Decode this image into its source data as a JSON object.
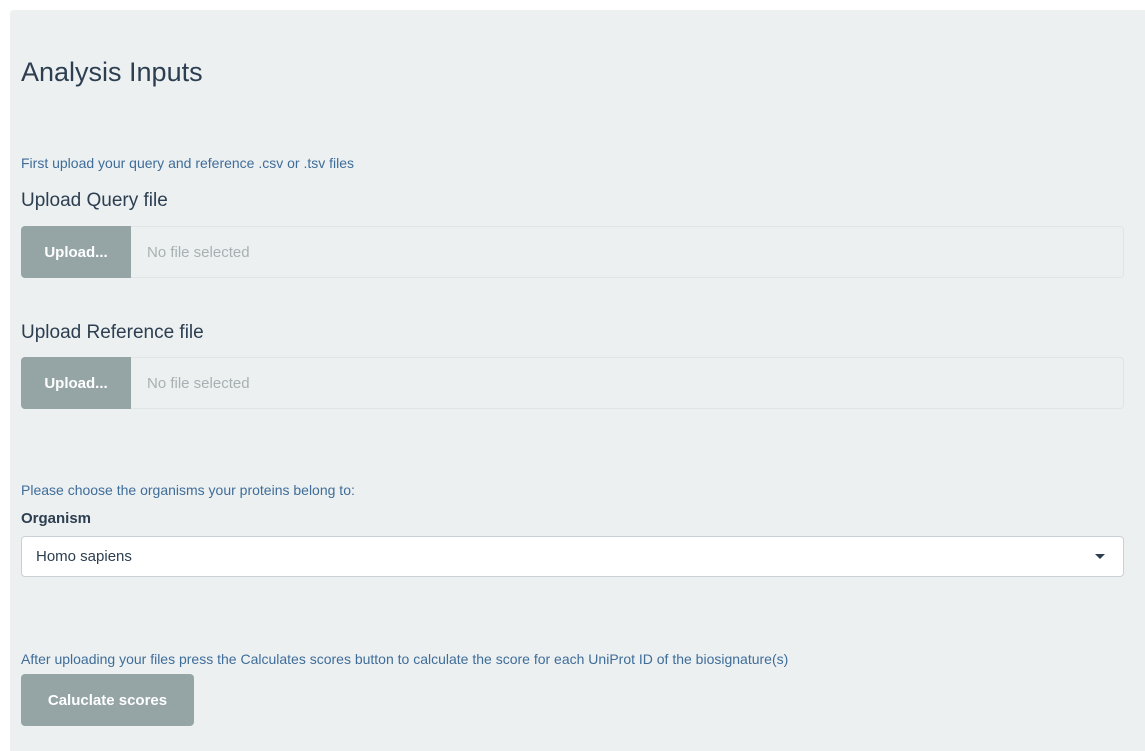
{
  "page": {
    "title": "Analysis Inputs"
  },
  "upload_section": {
    "help_text": "First upload your query and reference .csv or .tsv files",
    "query": {
      "label": "Upload Query file",
      "button_label": "Upload...",
      "status": "No file selected"
    },
    "reference": {
      "label": "Upload Reference file",
      "button_label": "Upload...",
      "status": "No file selected"
    }
  },
  "organism_section": {
    "help_text": "Please choose the organisms your proteins belong to:",
    "label": "Organism",
    "selected": "Homo sapiens",
    "icon": "chevron-down-icon"
  },
  "calculate_section": {
    "help_text": "After uploading your files press the Calculates scores button to calculate the score for each UniProt ID of the biosignature(s)",
    "button_label": "Caluclate scores"
  },
  "colors": {
    "panel_background": "#ecf0f1",
    "button_gray": "#95a5a6",
    "help_text_blue": "#3f6d99",
    "heading_text": "#2c3e50"
  }
}
